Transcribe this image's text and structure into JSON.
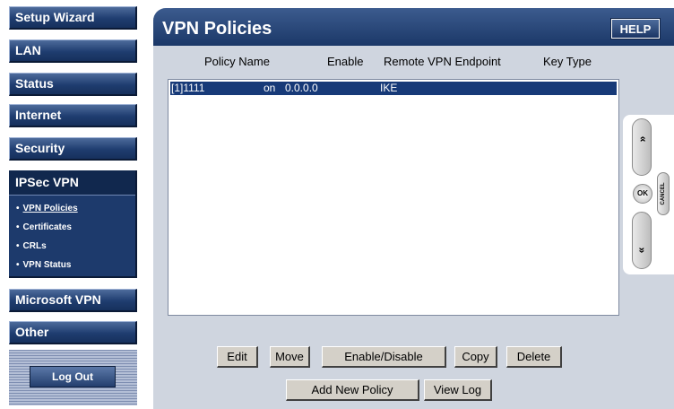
{
  "sidebar": {
    "setup_wizard": "Setup Wizard",
    "lan": "LAN",
    "status": "Status",
    "internet": "Internet",
    "security": "Security",
    "ipsec_vpn": "IPSec VPN",
    "ipsec_items": [
      {
        "label": "VPN Policies",
        "active": true
      },
      {
        "label": "Certificates"
      },
      {
        "label": "CRLs"
      },
      {
        "label": "VPN Status"
      }
    ],
    "microsoft_vpn": "Microsoft VPN",
    "other": "Other",
    "logout": "Log Out"
  },
  "main": {
    "title": "VPN Policies",
    "help": "HELP",
    "columns": [
      "Policy Name",
      "Enable",
      "Remote VPN Endpoint",
      "Key Type"
    ],
    "rows": [
      {
        "name": "[1]1111",
        "enable": "on",
        "endpoint": "0.0.0.0",
        "key_type": "IKE",
        "selected": true
      }
    ],
    "buttons": {
      "edit": "Edit",
      "move": "Move",
      "enable_disable": "Enable/Disable",
      "copy": "Copy",
      "delete": "Delete",
      "add_new_policy": "Add New Policy",
      "view_log": "View Log"
    }
  },
  "remote": {
    "up_icon": "double-chevron-up-icon",
    "down_icon": "double-chevron-down-icon",
    "ok": "OK",
    "cancel": "CANCEL"
  },
  "colors": {
    "nav_blue": "#1f3d70",
    "panel_bg": "#cfd5df",
    "selection": "#173a78"
  }
}
